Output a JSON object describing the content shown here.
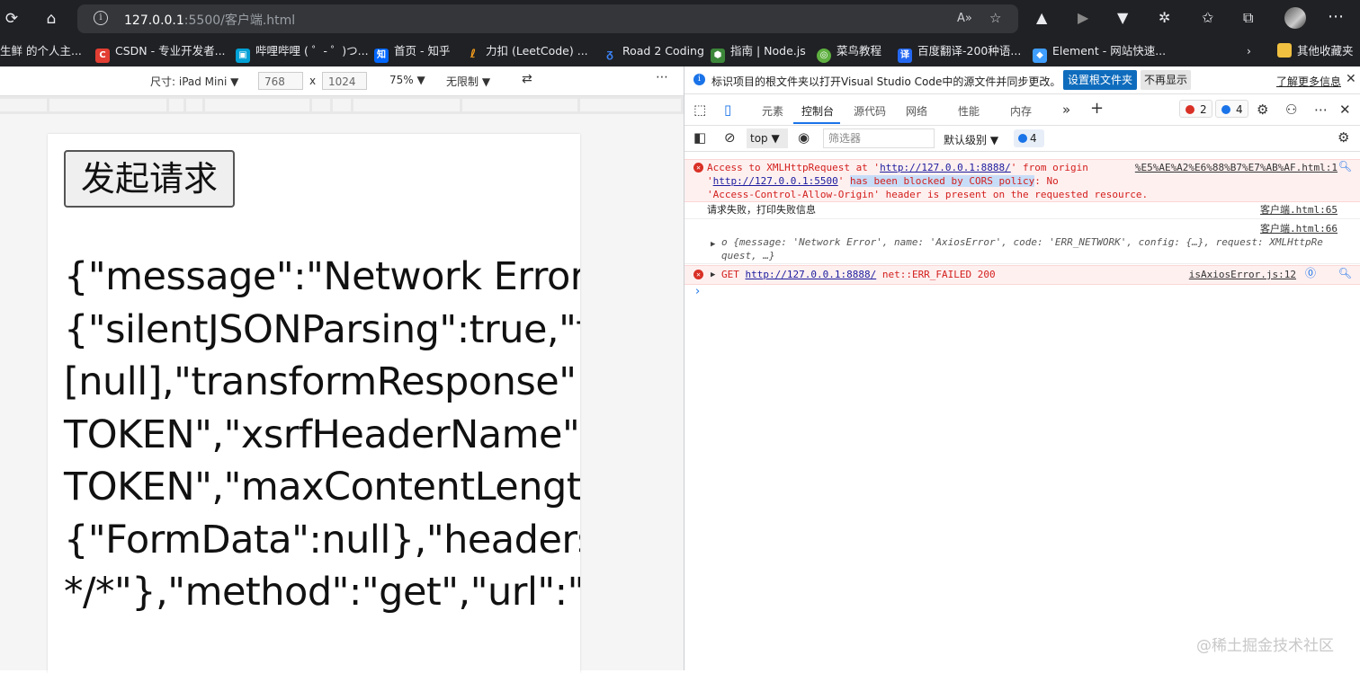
{
  "browser": {
    "url_host": "127.0.0.1",
    "url_rest": ":5500/客户端.html"
  },
  "bookmarks": [
    {
      "label": "生鲜 的个人主...",
      "color": "#202124"
    },
    {
      "label": "CSDN - 专业开发者...",
      "color": "#e33e33"
    },
    {
      "label": "哔哩哔哩 ( ゜- ゜)つ...",
      "color": "#00a1d6"
    },
    {
      "label": "首页 - 知乎",
      "color": "#0066ff"
    },
    {
      "label": "力扣 (LeetCode) ...",
      "color": "#202124"
    },
    {
      "label": "Road 2 Coding",
      "color": "#3b82f6"
    },
    {
      "label": "指南 | Node.js",
      "color": "#3c873a"
    },
    {
      "label": "菜鸟教程",
      "color": "#5fb041"
    },
    {
      "label": "百度翻译-200种语...",
      "color": "#2468f2"
    },
    {
      "label": "Element - 网站快速...",
      "color": "#409eff"
    },
    {
      "label": "其他收藏夹",
      "color": "#f0c040"
    }
  ],
  "device_toolbar": {
    "dimensions_label": "尺寸: iPad Mini",
    "width": "768",
    "height": "1024",
    "times": "x",
    "zoom": "75%",
    "throttle": "无限制"
  },
  "page": {
    "button_label": "发起请求",
    "result_text": "{\"message\":\"Network Error\"\n{\"silentJSONParsing\":true,\"f\n[null],\"transformResponse\":\nTOKEN\",\"xsrfHeaderName\"\nTOKEN\",\"maxContentLengt\n{\"FormData\":null},\"headers\"\n*/*\"},\"method\":\"get\",\"url\":\"h"
  },
  "devtools": {
    "infobar": {
      "text": "标识项目的根文件夹以打开Visual Studio Code中的源文件并同步更改。",
      "set_root": "设置根文件夹",
      "dont_show": "不再显示",
      "learn_more": "了解更多信息"
    },
    "tabs": [
      "元素",
      "控制台",
      "源代码",
      "网络",
      "性能",
      "内存"
    ],
    "error_count": "2",
    "message_count": "4",
    "filter": {
      "context": "top",
      "placeholder": "筛选器",
      "level": "默认级别",
      "count": "4"
    },
    "console": {
      "cors_prefix": "Access to XMLHttpRequest at '",
      "cors_url1": "http://127.0.0.1:8888/",
      "cors_mid": "' from origin",
      "cors_line2_pre": "'",
      "cors_url2": "http://127.0.0.1:5500",
      "cors_line2_post": "' ",
      "cors_blocked": "has been blocked by CORS policy",
      "cors_line2_end": ": No",
      "cors_line3": "'Access-Control-Allow-Origin' header is present on the requested resource.",
      "cors_source": "%E5%AE%A2%E6%88%B7%E7%AB%AF.html:1",
      "log1_text": "请求失败，打印失败信息",
      "log1_source": "客户端.html:65",
      "log2_source": "客户端.html:66",
      "log2_line1": "o {message: 'Network Error', name: 'AxiosError', code: 'ERR_NETWORK', config: {…}, request: XMLHttpRe",
      "log2_line2": "quest, …}",
      "get_prefix": "GET",
      "get_url": "http://127.0.0.1:8888/",
      "get_suffix": "net::ERR_FAILED 200",
      "get_source": "isAxiosError.js:12"
    }
  },
  "watermark": "@稀土掘金技术社区"
}
